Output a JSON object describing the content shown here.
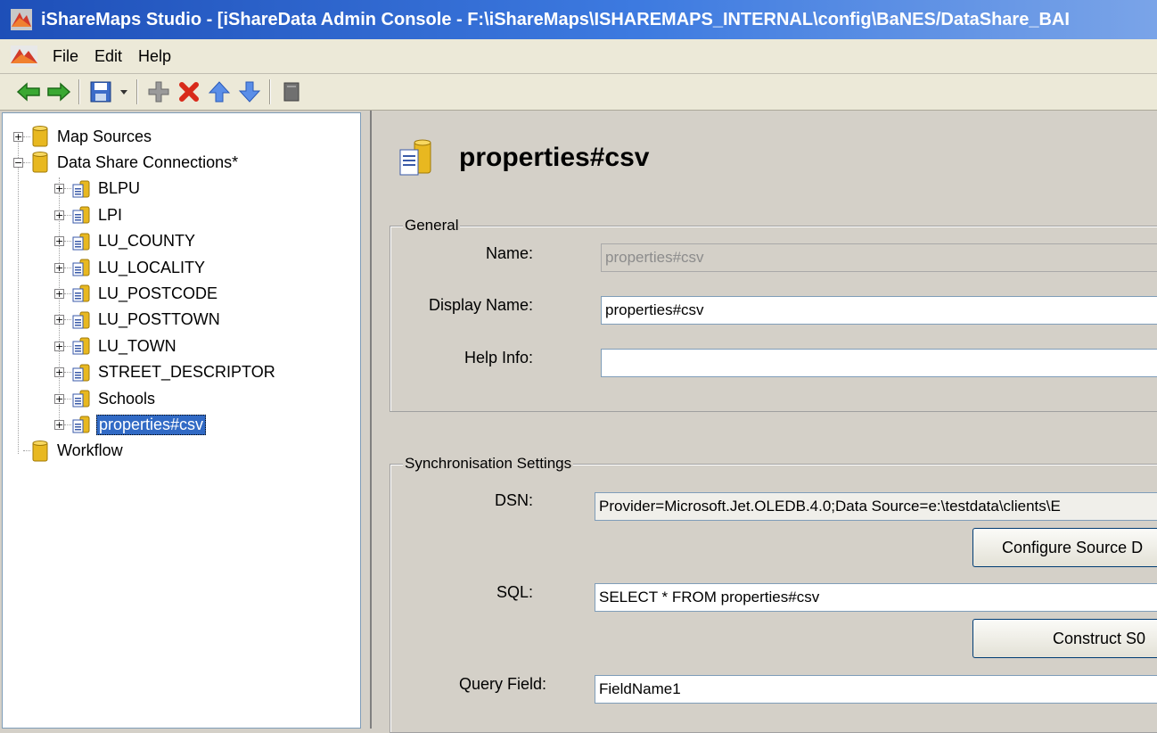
{
  "window": {
    "title": "iShareMaps Studio - [iShareData Admin Console - F:\\iShareMaps\\ISHAREMAPS_INTERNAL\\config\\BaNES/DataShare_BAI"
  },
  "menu": {
    "items": [
      "File",
      "Edit",
      "Help"
    ]
  },
  "toolbar": {
    "icons": [
      "back-arrow-icon",
      "forward-arrow-icon",
      "save-icon",
      "dropdown-arrow-icon",
      "add-icon",
      "delete-icon",
      "move-up-icon",
      "move-down-icon",
      "properties-icon"
    ]
  },
  "tree": {
    "root_items": [
      {
        "label": "Map Sources",
        "expanded": false
      },
      {
        "label": "Data Share Connections*",
        "expanded": true
      },
      {
        "label": "Workflow",
        "expanded": false
      }
    ],
    "connections": [
      "BLPU",
      "LPI",
      "LU_COUNTY",
      "LU_LOCALITY",
      "LU_POSTCODE",
      "LU_POSTTOWN",
      "LU_TOWN",
      "STREET_DESCRIPTOR",
      "Schools",
      "properties#csv"
    ],
    "selected": "properties#csv"
  },
  "detail": {
    "title": "properties#csv",
    "general": {
      "legend": "General",
      "name_label": "Name:",
      "name_value": "properties#csv",
      "display_name_label": "Display Name:",
      "display_name_value": "properties#csv",
      "help_info_label": "Help Info:",
      "help_info_value": ""
    },
    "sync": {
      "legend": "Synchronisation Settings",
      "dsn_label": "DSN:",
      "dsn_value": "Provider=Microsoft.Jet.OLEDB.4.0;Data Source=e:\\testdata\\clients\\E",
      "configure_button": "Configure Source D",
      "sql_label": "SQL:",
      "sql_value": "SELECT * FROM properties#csv",
      "construct_button": "Construct S0",
      "query_field_label": "Query Field:",
      "query_field_value": "FieldName1"
    }
  },
  "colors": {
    "title_bar": "#1e4fb8",
    "selection": "#316ac5",
    "background": "#d4d0c8"
  }
}
